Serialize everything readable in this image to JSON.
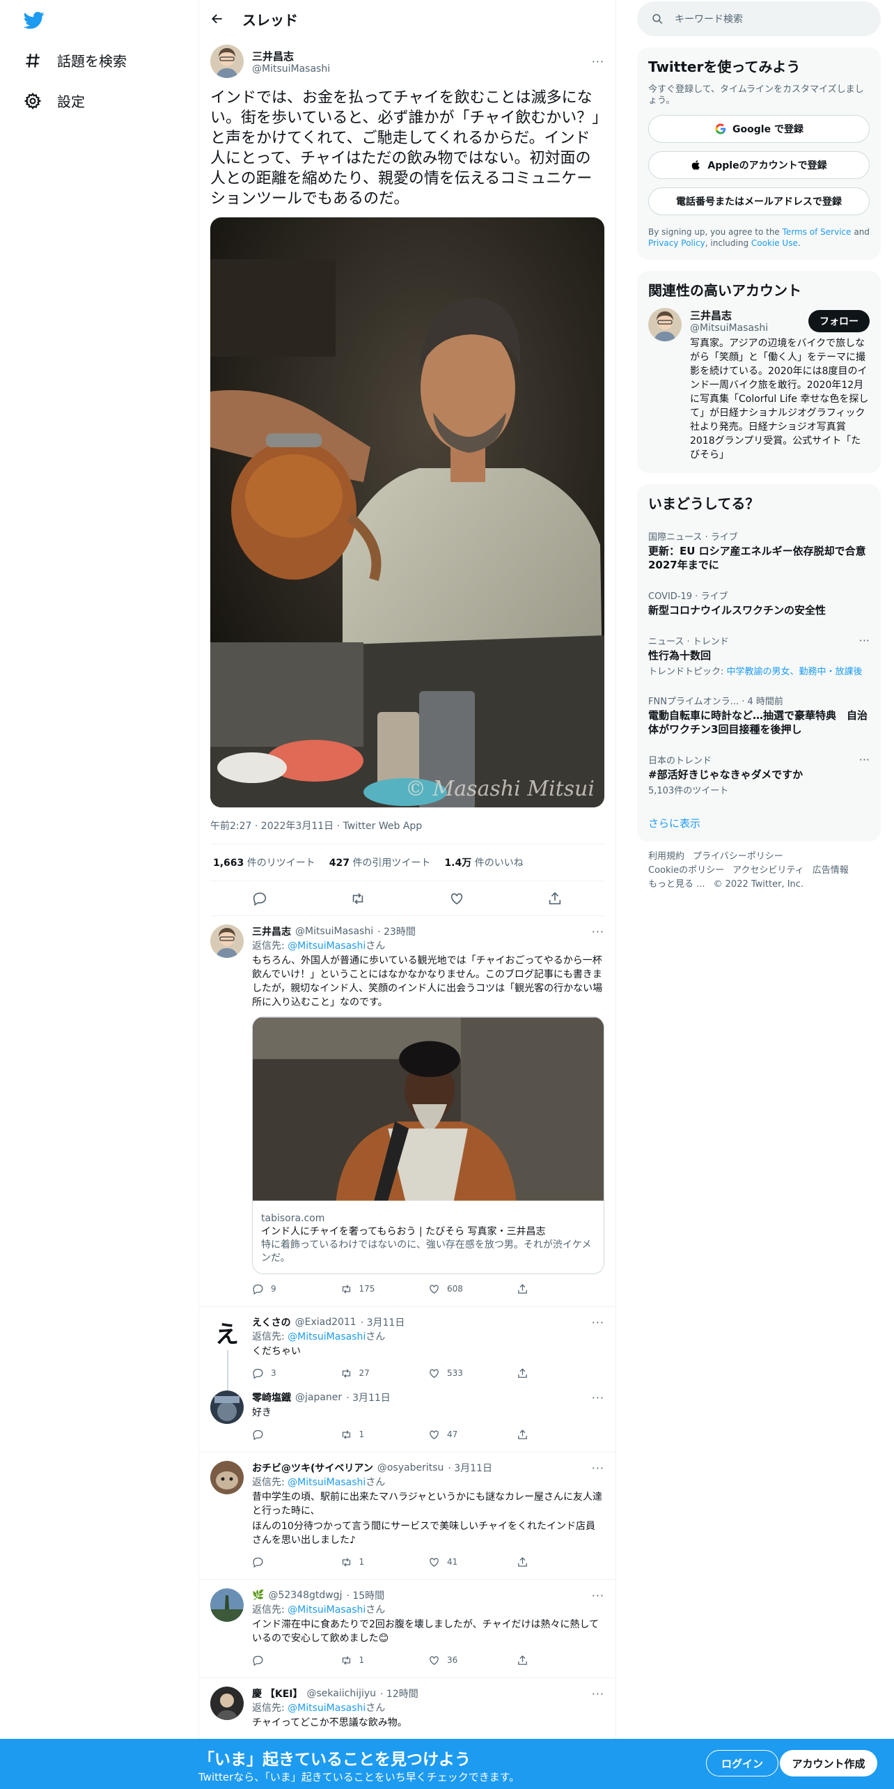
{
  "nav": {
    "explore": "話題を検索",
    "settings": "設定"
  },
  "header": {
    "title": "スレッド"
  },
  "main_tweet": {
    "name": "三井昌志",
    "handle": "@MitsuiMasashi",
    "text": "インドでは、お金を払ってチャイを飲むことは滅多にない。街を歩いていると、必ず誰かが「チャイ飲むかい？」と声をかけてくれて、ご馳走してくれるからだ。インド人にとって、チャイはただの飲み物ではない。初対面の人との距離を縮めたり、親愛の情を伝えるコミュニケーションツールでもあるのだ。",
    "watermark": "© Masashi Mitsui",
    "meta": "午前2:27 · 2022年3月11日 · Twitter Web App",
    "retweets_num": "1,663",
    "retweets_label": "件のリツイート",
    "quotes_num": "427",
    "quotes_label": "件の引用ツイート",
    "likes_num": "1.4万",
    "likes_label": "件のいいね"
  },
  "replies": [
    {
      "name": "三井昌志",
      "handle": "@MitsuiMasashi",
      "time": "· 23時間",
      "reply_prefix": "返信先: ",
      "reply_to": "@MitsuiMasashi",
      "reply_suffix": "さん",
      "text": "もちろん、外国人が普通に歩いている観光地では「チャイおごってやるから一杯飲んでいけ！」ということにはなかなかなりません。このブログ記事にも書きましたが，親切なインド人、笑顔のインド人に出会うコツは「観光客の行かない場所に入り込むこと」なのです。",
      "card_domain": "tabisora.com",
      "card_title": "インド人にチャイを奢ってもらおう | たびそら 写真家・三井昌志",
      "card_desc": "特に着飾っているわけではないのに、強い存在感を放つ男。それが渋イケメンだ。",
      "replies": "9",
      "retweets": "175",
      "likes": "608"
    },
    {
      "name": "えくさの",
      "handle": "@Exiad2011",
      "time": "· 3月11日",
      "reply_prefix": "返信先: ",
      "reply_to": "@MitsuiMasashi",
      "reply_suffix": "さん",
      "text": "くだちゃい",
      "avatar_char": "え",
      "replies": "3",
      "retweets": "27",
      "likes": "533"
    },
    {
      "name": "零崎塩鐡",
      "handle": "@japaner",
      "time": "· 3月11日",
      "text": "好き",
      "replies": "",
      "retweets": "1",
      "likes": "47"
    },
    {
      "name": "おチビ@ツキ(サイベリアン",
      "handle": "@osyaberitsu",
      "time": "· 3月11日",
      "reply_prefix": "返信先: ",
      "reply_to": "@MitsuiMasashi",
      "reply_suffix": "さん",
      "text1": "昔中学生の頃、駅前に出来たマハラジャというかにも謎なカレー屋さんに友人達と行った時に、",
      "text2": "ほんの10分待つかって言う間にサービスで美味しいチャイをくれたインド店員さんを思い出しました♪",
      "replies": "",
      "retweets": "1",
      "likes": "41"
    },
    {
      "name": "🌿",
      "handle": "@52348gtdwgj",
      "time": "· 15時間",
      "reply_prefix": "返信先: ",
      "reply_to": "@MitsuiMasashi",
      "reply_suffix": "さん",
      "text": "インド滞在中に食あたりで2回お腹を壊しましたが、チャイだけは熱々に熱しているので安心して飲めました😊",
      "replies": "",
      "retweets": "1",
      "likes": "36"
    },
    {
      "name": "慶 【KEI】",
      "handle": "@sekaiichijiyu",
      "time": "· 12時間",
      "reply_prefix": "返信先: ",
      "reply_to": "@MitsuiMasashi",
      "reply_suffix": "さん",
      "text": "チャイってどこか不思議な飲み物。"
    }
  ],
  "search": {
    "placeholder": "キーワード検索"
  },
  "signup_panel": {
    "title": "Twitterを使ってみよう",
    "sub": "今すぐ登録して、タイムラインをカスタマイズしましょう。",
    "google": "Google で登録",
    "apple": "Appleのアカウントで登録",
    "phone": "電話番号またはメールアドレスで登録",
    "terms_pre": "By signing up, you agree to the ",
    "terms_link": "Terms of Service",
    "terms_mid": " and ",
    "privacy_link": "Privacy Policy",
    "terms_mid2": ", including ",
    "cookie_link": "Cookie Use",
    "terms_end": "."
  },
  "related": {
    "title": "関連性の高いアカウント",
    "name": "三井昌志",
    "handle": "@MitsuiMasashi",
    "follow": "フォロー",
    "bio": "写真家。アジアの辺境をバイクで旅しながら「笑顔」と「働く人」をテーマに撮影を続けている。2020年には8度目のインド一周バイク旅を敢行。2020年12月に写真集「Colorful Life 幸せな色を探して」が日経ナショナルジオグラフィック社より発売。日経ナショジオ写真賞2018グランプリ受賞。公式サイト「たびそら」"
  },
  "trends": {
    "title": "いまどうしてる？",
    "items": [
      {
        "cat": "国際ニュース · ライブ",
        "title": "更新：EU ロシア産エネルギー依存脱却で合意 2027年までに"
      },
      {
        "cat": "COVID-19 · ライブ",
        "title": "新型コロナウイルスワクチンの安全性"
      },
      {
        "cat": "ニュース · トレンド",
        "title": "性行為十数回",
        "sub_pre": "トレンドトピック: ",
        "sub_link": "中学教諭の男女、勤務中・放課後"
      },
      {
        "cat": "FNNプライムオンラ... · 4 時間前",
        "title": "電動自転車に時計など…抽選で豪華特典　自治体がワクチン3回目接種を後押し"
      },
      {
        "cat": "日本のトレンド",
        "title": "#部活好きじゃなきゃダメですか",
        "sub": "5,103件のツイート"
      }
    ],
    "show_more": "さらに表示"
  },
  "footer": {
    "l1": "利用規約",
    "l2": "プライバシーポリシー",
    "l3": "Cookieのポリシー",
    "l4": "アクセシビリティ",
    "l5": "広告情報",
    "l6": "もっと見る ...",
    "copy": "© 2022 Twitter, Inc."
  },
  "bottom_bar": {
    "headline": "「いま」起きていることを見つけよう",
    "sub": "Twitterなら、「いま」起きていることをいち早くチェックできます。",
    "login": "ログイン",
    "signup": "アカウント作成"
  },
  "colors": {
    "accent": "#1d9bf0",
    "text": "#0f1419",
    "muted": "#536471"
  }
}
